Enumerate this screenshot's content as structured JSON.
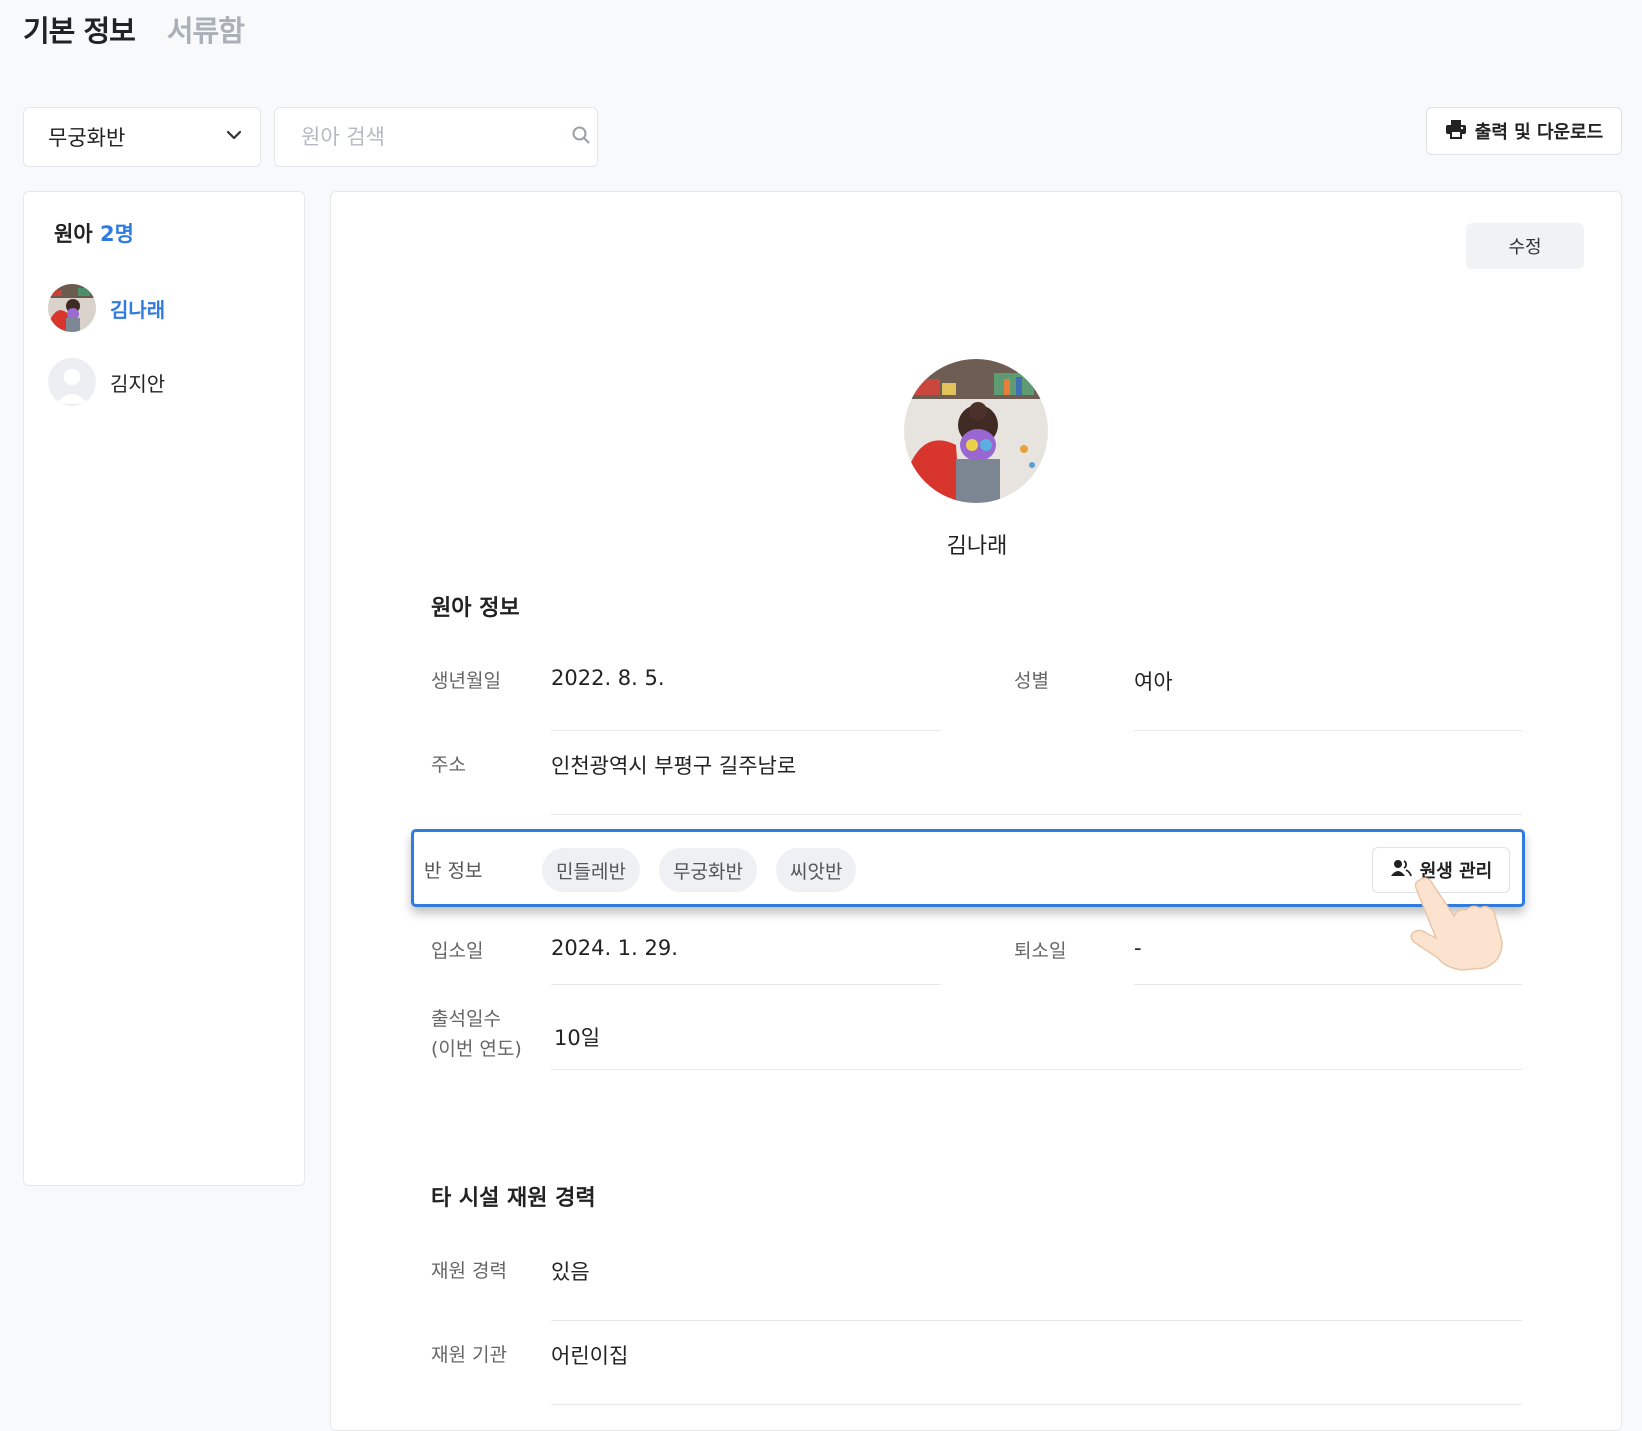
{
  "tabs": {
    "basic": "기본 정보",
    "docs": "서류함"
  },
  "filter": {
    "class_selected": "무궁화반",
    "search_placeholder": "원아 검색"
  },
  "toolbar": {
    "print_label": "출력 및 다운로드"
  },
  "sidebar": {
    "count_label": "원아",
    "count_value": "2명",
    "children": [
      {
        "name": "김나래"
      },
      {
        "name": "김지안"
      }
    ]
  },
  "profile": {
    "edit_label": "수정",
    "name": "김나래"
  },
  "child_info": {
    "title": "원아 정보",
    "birth_label": "생년월일",
    "birth_value": "2022. 8. 5.",
    "gender_label": "성별",
    "gender_value": "여아",
    "address_label": "주소",
    "address_value": "인천광역시 부평구 길주남로",
    "class_label": "반 정보",
    "classes": [
      "민들레반",
      "무궁화반",
      "씨앗반"
    ],
    "manage_label": "원생 관리",
    "admit_label": "입소일",
    "admit_value": "2024. 1. 29.",
    "leave_label": "퇴소일",
    "leave_value": "-",
    "attend_label": "출석일수",
    "attend_sub": "(이번 연도)",
    "attend_value": "10일"
  },
  "history": {
    "title": "타 시설 재원 경력",
    "career_label": "재원 경력",
    "career_value": "있음",
    "org_label": "재원 기관",
    "org_value": "어린이집"
  },
  "colors": {
    "accent": "#2f7be0"
  }
}
